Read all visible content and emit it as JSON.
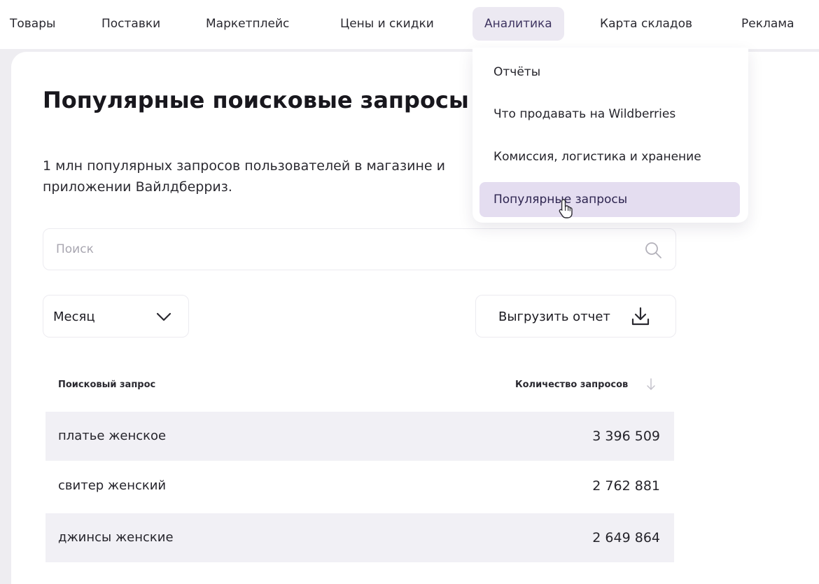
{
  "nav": {
    "items": [
      {
        "label": "Товары"
      },
      {
        "label": "Поставки"
      },
      {
        "label": "Маркетплейс"
      },
      {
        "label": "Цены и скидки"
      },
      {
        "label": "Аналитика",
        "active": true
      },
      {
        "label": "Карта складов"
      },
      {
        "label": "Реклама"
      }
    ]
  },
  "dropdown": {
    "items": [
      {
        "label": "Отчёты"
      },
      {
        "label": "Что продавать на Wildberries"
      },
      {
        "label": "Комиссия, логистика и хранение"
      },
      {
        "label": "Популярные запросы",
        "hovered": true
      }
    ]
  },
  "page": {
    "title": "Популярные поисковые запросы",
    "description": "1 млн популярных запросов пользователей в магазине и приложении Вайлдберриз."
  },
  "search": {
    "placeholder": "Поиск",
    "icon": "search-icon"
  },
  "period_select": {
    "value": "Месяц",
    "icon": "chevron-down-icon"
  },
  "export": {
    "label": "Выгрузить отчет",
    "icon": "download-icon"
  },
  "table": {
    "columns": [
      "Поисковый запрос",
      "Количество запросов"
    ],
    "sort_icon": "arrow-down-icon",
    "rows": [
      {
        "query": "платье женское",
        "count": "3 396 509"
      },
      {
        "query": "свитер женский",
        "count": "2 762 881"
      },
      {
        "query": "джинсы женские",
        "count": "2 649 864"
      }
    ]
  },
  "colors": {
    "accent_active_bg": "#ece9f2",
    "dropdown_hover_bg": "#e4ddf0",
    "row_shade": "#f1f0f5",
    "page_bg": "#eeedf1"
  }
}
